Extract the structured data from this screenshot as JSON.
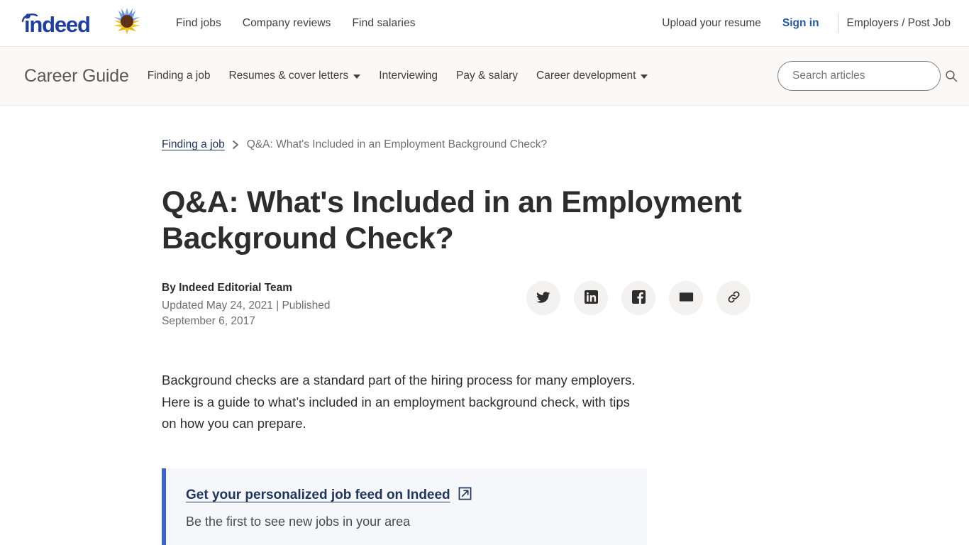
{
  "header": {
    "logo_alt": "indeed",
    "nav": [
      {
        "label": "Find jobs"
      },
      {
        "label": "Company reviews"
      },
      {
        "label": "Find salaries"
      }
    ],
    "upload_resume": "Upload your resume",
    "sign_in": "Sign in",
    "employers": "Employers / Post Job",
    "brand_color": "#2557a7"
  },
  "career_guide": {
    "title": "Career Guide",
    "nav": [
      {
        "label": "Finding a job",
        "has_caret": false
      },
      {
        "label": "Resumes & cover letters",
        "has_caret": true
      },
      {
        "label": "Interviewing",
        "has_caret": false
      },
      {
        "label": "Pay & salary",
        "has_caret": false
      },
      {
        "label": "Career development",
        "has_caret": true
      }
    ],
    "search": {
      "placeholder": "Search articles",
      "value": "",
      "icon": "search-icon"
    },
    "background": "#faf9f8"
  },
  "breadcrumb": {
    "parent": "Finding a job",
    "separator": "chevron-right-icon",
    "current": "Q&A: What's Included in an Employment Background Check?"
  },
  "article": {
    "title": "Q&A: What's Included in an Employment Background Check?",
    "author": "By Indeed Editorial Team",
    "dates": "Updated May 24, 2021 | Published September 6, 2017",
    "intro": "Background checks are a standard part of the hiring process for many employers. Here is a guide to what’s included in an employment background check, with tips on how you can prepare.",
    "share_buttons": [
      {
        "name": "twitter-icon",
        "label": "Share on Twitter"
      },
      {
        "name": "linkedin-icon",
        "label": "Share on LinkedIn"
      },
      {
        "name": "facebook-icon",
        "label": "Share on Facebook"
      },
      {
        "name": "email-icon",
        "label": "Share by email"
      },
      {
        "name": "link-icon",
        "label": "Copy link"
      }
    ]
  },
  "callout": {
    "link_text": "Get your personalized job feed on Indeed",
    "link_icon": "external-link-icon",
    "subtitle": "Be the first to see new jobs in your area",
    "accent_color": "#3c63c6",
    "background": "#f6f7fb"
  }
}
